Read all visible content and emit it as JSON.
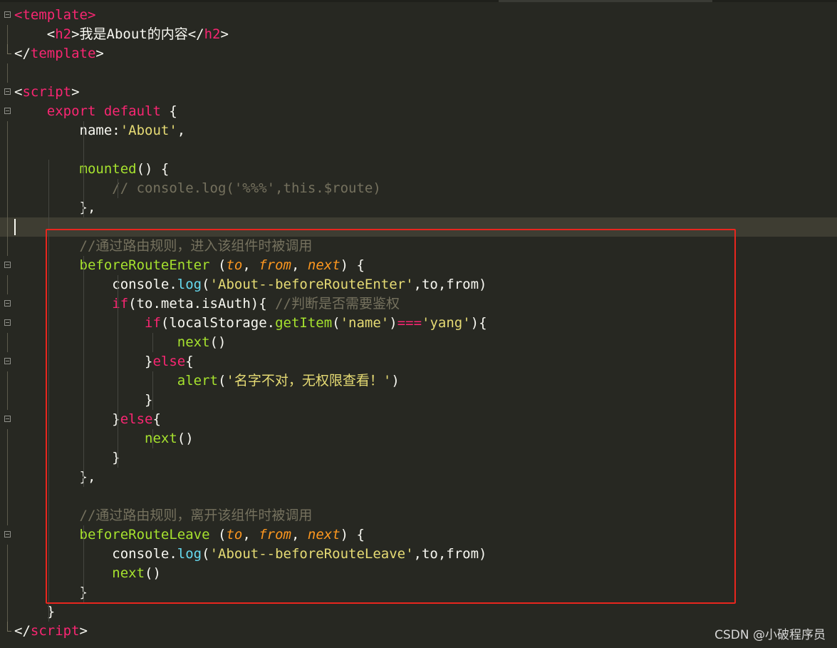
{
  "editor": {
    "theme_colors": {
      "background": "#272822",
      "tag": "#f92672",
      "function": "#a6e22e",
      "string": "#e6db74",
      "comment": "#75715e",
      "argument": "#fd971f",
      "highlight_box": "#e8261e"
    },
    "lines": [
      [
        [
          "t",
          "<"
        ],
        [
          "t",
          "template"
        ],
        [
          "t",
          ">"
        ]
      ],
      [
        [
          "p",
          "    <"
        ],
        [
          "t",
          "h2"
        ],
        [
          "p",
          ">我是About的内容</"
        ],
        [
          "t",
          "h2"
        ],
        [
          "p",
          ">"
        ]
      ],
      [
        [
          "p",
          "</"
        ],
        [
          "t",
          "template"
        ],
        [
          "p",
          ">"
        ]
      ],
      [],
      [
        [
          "p",
          "<"
        ],
        [
          "t",
          "script"
        ],
        [
          "p",
          ">"
        ]
      ],
      [
        [
          "p",
          "    "
        ],
        [
          "k",
          "export default"
        ],
        [
          "p",
          " {"
        ]
      ],
      [
        [
          "p",
          "        name:"
        ],
        [
          "s",
          "'About'"
        ],
        [
          "p",
          ","
        ]
      ],
      [],
      [
        [
          "p",
          "        "
        ],
        [
          "f",
          "mounted"
        ],
        [
          "p",
          "() {"
        ]
      ],
      [
        [
          "p",
          "            "
        ],
        [
          "c",
          "// console.log('%%%',this.$route)"
        ]
      ],
      [
        [
          "p",
          "        },"
        ]
      ],
      [],
      [
        [
          "p",
          "        "
        ],
        [
          "c",
          "//通过路由规则，进入该组件时被调用"
        ]
      ],
      [
        [
          "p",
          "        "
        ],
        [
          "f",
          "beforeRouteEnter"
        ],
        [
          "p",
          " ("
        ],
        [
          "a",
          "to"
        ],
        [
          "p",
          ", "
        ],
        [
          "a",
          "from"
        ],
        [
          "p",
          ", "
        ],
        [
          "a",
          "next"
        ],
        [
          "p",
          ") {"
        ]
      ],
      [
        [
          "p",
          "            console."
        ],
        [
          "b",
          "log"
        ],
        [
          "p",
          "("
        ],
        [
          "s",
          "'About--beforeRouteEnter'"
        ],
        [
          "p",
          ",to,from)"
        ]
      ],
      [
        [
          "p",
          "            "
        ],
        [
          "k",
          "if"
        ],
        [
          "p",
          "(to.meta.isAuth){ "
        ],
        [
          "c",
          "//判断是否需要鉴权"
        ]
      ],
      [
        [
          "p",
          "                "
        ],
        [
          "k",
          "if"
        ],
        [
          "p",
          "(localStorage."
        ],
        [
          "f",
          "getItem"
        ],
        [
          "p",
          "("
        ],
        [
          "s",
          "'name'"
        ],
        [
          "p",
          ")"
        ],
        [
          "k",
          "==="
        ],
        [
          "s",
          "'yang'"
        ],
        [
          "p",
          "){"
        ]
      ],
      [
        [
          "p",
          "                    "
        ],
        [
          "f",
          "next"
        ],
        [
          "p",
          "()"
        ]
      ],
      [
        [
          "p",
          "                }"
        ],
        [
          "k",
          "else"
        ],
        [
          "p",
          "{"
        ]
      ],
      [
        [
          "p",
          "                    "
        ],
        [
          "f",
          "alert"
        ],
        [
          "p",
          "("
        ],
        [
          "s",
          "'名字不对，无权限查看！'"
        ],
        [
          "p",
          ")"
        ]
      ],
      [
        [
          "p",
          "                }"
        ]
      ],
      [
        [
          "p",
          "            }"
        ],
        [
          "k",
          "else"
        ],
        [
          "p",
          "{"
        ]
      ],
      [
        [
          "p",
          "                "
        ],
        [
          "f",
          "next"
        ],
        [
          "p",
          "()"
        ]
      ],
      [
        [
          "p",
          "            }"
        ]
      ],
      [
        [
          "p",
          "        },"
        ]
      ],
      [],
      [
        [
          "p",
          "        "
        ],
        [
          "c",
          "//通过路由规则，离开该组件时被调用"
        ]
      ],
      [
        [
          "p",
          "        "
        ],
        [
          "f",
          "beforeRouteLeave"
        ],
        [
          "p",
          " ("
        ],
        [
          "a",
          "to"
        ],
        [
          "p",
          ", "
        ],
        [
          "a",
          "from"
        ],
        [
          "p",
          ", "
        ],
        [
          "a",
          "next"
        ],
        [
          "p",
          ") {"
        ]
      ],
      [
        [
          "p",
          "            console."
        ],
        [
          "b",
          "log"
        ],
        [
          "p",
          "("
        ],
        [
          "s",
          "'About--beforeRouteLeave'"
        ],
        [
          "p",
          ",to,from)"
        ]
      ],
      [
        [
          "p",
          "            "
        ],
        [
          "f",
          "next"
        ],
        [
          "p",
          "()"
        ]
      ],
      [
        [
          "p",
          "        }"
        ]
      ],
      [
        [
          "p",
          "    }"
        ]
      ],
      [
        [
          "p",
          "</"
        ],
        [
          "t",
          "script"
        ],
        [
          "p",
          ">"
        ]
      ]
    ],
    "gutter": {
      "fold_open": [
        0,
        4,
        5,
        13,
        15,
        16,
        18,
        21,
        27
      ],
      "fold_end": [
        2,
        32
      ],
      "fold_line": [
        1,
        3,
        5,
        6,
        7,
        8,
        9,
        10,
        11,
        12,
        14,
        17,
        19,
        20,
        22,
        23,
        24,
        25,
        26,
        28,
        29,
        30,
        31
      ]
    },
    "active_line": 11
  },
  "watermark": "CSDN @小破程序员"
}
